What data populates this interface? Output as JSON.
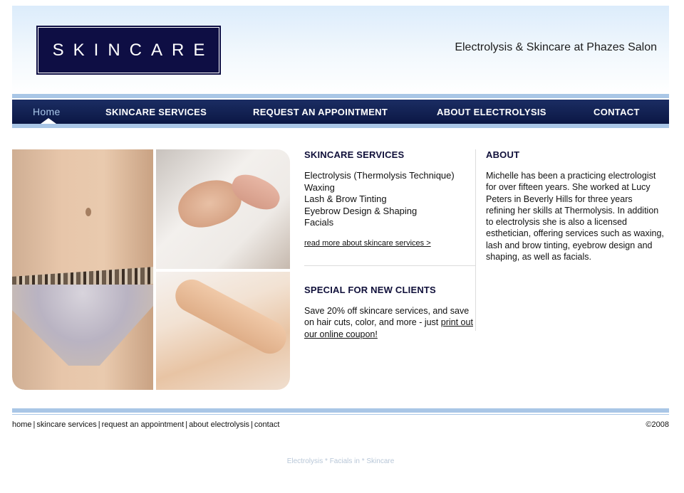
{
  "header": {
    "logo_text": "SKINCARE",
    "tagline": "Electrolysis & Skincare at Phazes Salon"
  },
  "nav": {
    "items": [
      {
        "label": "Home",
        "active": true
      },
      {
        "label": "SKINCARE SERVICES",
        "active": false
      },
      {
        "label": "REQUEST AN APPOINTMENT",
        "active": false
      },
      {
        "label": "ABOUT ELECTROLYSIS",
        "active": false
      },
      {
        "label": "CONTACT",
        "active": false
      }
    ]
  },
  "services": {
    "heading": "SKINCARE SERVICES",
    "items": [
      "Electrolysis (Thermolysis Technique)",
      "Waxing",
      "Lash & Brow Tinting",
      "Eyebrow Design & Shaping",
      "Facials"
    ],
    "more_link": "read more about skincare services >"
  },
  "special": {
    "heading": "SPECIAL FOR NEW CLIENTS",
    "text": "Save 20% off skincare services, and save on hair cuts, color, and more - just",
    "link": "print out our online coupon!"
  },
  "about": {
    "heading": "ABOUT",
    "text": "Michelle has been a practicing electrologist for over fifteen years. She worked at Lucy Peters in Beverly Hills for three years refining her skills at Thermolysis. In addition to electrolysis she is also a licensed esthetician, offering services such as waxing, lash and brow tinting, eyebrow design and shaping, as well as facials."
  },
  "footer": {
    "links": [
      "home",
      "skincare services",
      "request an appointment",
      "about electrolysis",
      "contact"
    ],
    "separator": "|",
    "copyright": "©2008",
    "keywords": "Electrolysis * Facials in * Skincare"
  },
  "colors": {
    "logo_bg": "#0e0e44",
    "nav_bg": "#0b1744",
    "nav_active": "#a9c6e8",
    "accent_stripe": "#a9c6e6"
  }
}
